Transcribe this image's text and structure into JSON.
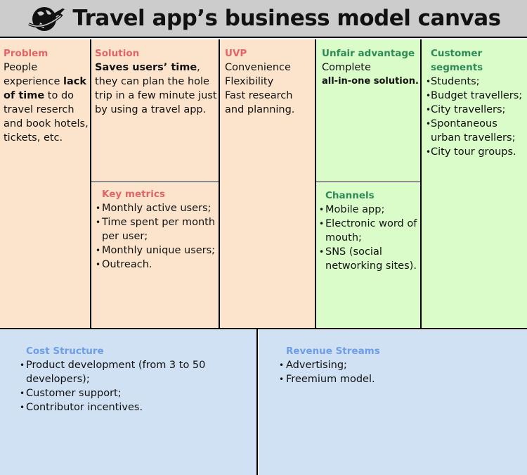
{
  "header": {
    "title": "Travel app’s business model canvas",
    "icon": "globe-airplane-icon"
  },
  "colors": {
    "peach": "#fce4cc",
    "green": "#d9fcc8",
    "blue": "#cfe1f2",
    "title_red": "#e06666",
    "title_green": "#2e8b57",
    "title_blue": "#6d9eeb"
  },
  "problem": {
    "title": "Problem",
    "text_1": "People experience ",
    "bold_1": "lack of time",
    "text_2": " to do travel reserch and book hotels, tickets, etc."
  },
  "solution": {
    "title": "Solution",
    "bold_1": "Saves users’ time",
    "text_1": ", they can plan the hole trip in a few minute just by using a travel app."
  },
  "key_metrics": {
    "title": "Key metrics",
    "items": [
      "Monthly active users;",
      "Time spent per month per user;",
      "Monthly unique users;",
      "Outreach."
    ]
  },
  "uvp": {
    "title": "UVP",
    "lines": [
      "Convenience",
      "Flexibility",
      "Fast research and planning."
    ]
  },
  "unfair_advantage": {
    "title": "Unfair advantage",
    "text_1": "Complete",
    "bold_1": "all-in-one solution."
  },
  "channels": {
    "title": "Channels",
    "items": [
      "Mobile app;",
      "Electronic word of mouth;",
      "SNS (social networking sites)."
    ]
  },
  "customer_segments": {
    "title": "Customer segments",
    "items": [
      "Students;",
      "Budget travellers;",
      "City travellers;",
      "Spontaneous urban travellers;",
      "City tour groups."
    ]
  },
  "cost_structure": {
    "title": "Cost Structure",
    "items": [
      "Product development (from 3 to 50 developers);",
      "Customer support;",
      "Contributor incentives."
    ]
  },
  "revenue_streams": {
    "title": "Revenue Streams",
    "items": [
      "Advertising;",
      "Freemium model."
    ]
  }
}
